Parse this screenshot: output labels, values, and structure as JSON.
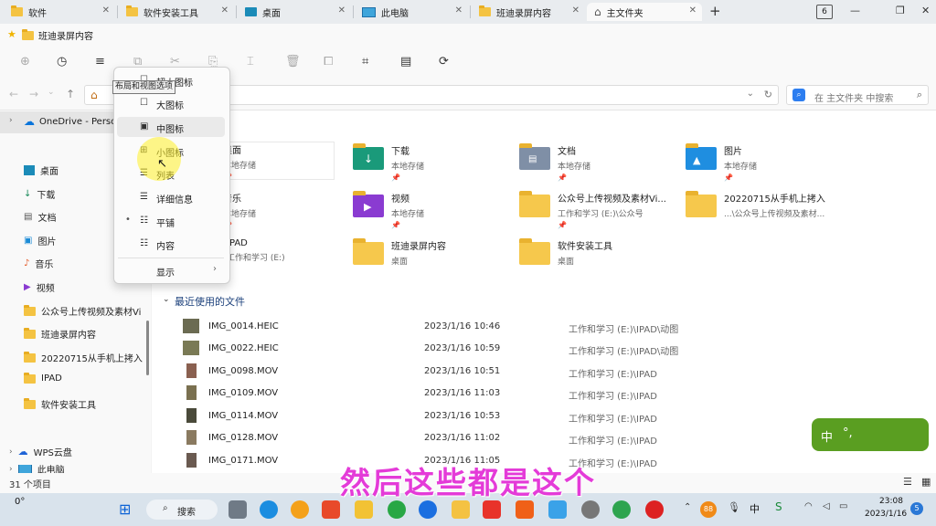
{
  "tabs": [
    {
      "label": "软件",
      "icon": "folder-icon"
    },
    {
      "label": "软件安装工具",
      "icon": "folder-icon"
    },
    {
      "label": "桌面",
      "icon": "desktop-icon"
    },
    {
      "label": "此电脑",
      "icon": "pc-icon"
    },
    {
      "label": "班迪录屏内容",
      "icon": "folder-icon"
    },
    {
      "label": "主文件夹",
      "icon": "home-icon"
    }
  ],
  "tab_count": "6",
  "tab_add": "+",
  "breadcrumb": "班迪录屏内容",
  "tooltip": "布局和视图选项",
  "search_placeholder": "在 主文件夹 中搜索",
  "view_menu": {
    "items": [
      {
        "label": "超大图标",
        "icon": "☐"
      },
      {
        "label": "大图标",
        "icon": "☐"
      },
      {
        "label": "中图标",
        "icon": "▣"
      },
      {
        "label": "小图标",
        "icon": "⊞"
      },
      {
        "label": "列表",
        "icon": "☰"
      },
      {
        "label": "详细信息",
        "icon": "☰"
      },
      {
        "label": "平铺",
        "icon": "☷"
      },
      {
        "label": "内容",
        "icon": "☷"
      }
    ],
    "bullet": "•",
    "show_label": "显示",
    "show_arrow": "›"
  },
  "sidebar": {
    "onedrive": "OneDrive - Personal",
    "items": [
      "桌面",
      "下载",
      "文档",
      "图片",
      "音乐",
      "视频",
      "公众号上传视频及素材Vi",
      "班迪录屏内容",
      "20220715从手机上拷入",
      "IPAD",
      "软件安装工具"
    ],
    "wps": "WPS云盘",
    "pc": "此电脑"
  },
  "quick_access": [
    {
      "name": "桌面",
      "sub": "本地存储",
      "pin": "📌"
    },
    {
      "name": "下载",
      "sub": "本地存储",
      "pin": "📌"
    },
    {
      "name": "文档",
      "sub": "本地存储",
      "pin": "📌"
    },
    {
      "name": "图片",
      "sub": "本地存储",
      "pin": "📌"
    },
    {
      "name": "音乐",
      "sub": "本地存储",
      "pin": "📌"
    },
    {
      "name": "视频",
      "sub": "本地存储",
      "pin": "📌"
    },
    {
      "name": "公众号上传视频及素材Vi...",
      "sub": "工作和学习 (E:)\\公众号",
      "pin": "📌"
    },
    {
      "name": "20220715从手机上拷入",
      "sub": "...\\公众号上传视频及素材...",
      "pin": ""
    },
    {
      "name": "IPAD",
      "sub": "工作和学习 (E:)",
      "pin": ""
    },
    {
      "name": "班迪录屏内容",
      "sub": "桌面",
      "pin": ""
    },
    {
      "name": "软件安装工具",
      "sub": "桌面",
      "pin": ""
    }
  ],
  "recent_title": "最近使用的文件",
  "recent": [
    {
      "name": "IMG_0014.HEIC",
      "date": "2023/1/16 10:46",
      "loc": "工作和学习 (E:)\\IPAD\\动图"
    },
    {
      "name": "IMG_0022.HEIC",
      "date": "2023/1/16 10:59",
      "loc": "工作和学习 (E:)\\IPAD\\动图"
    },
    {
      "name": "IMG_0098.MOV",
      "date": "2023/1/16 10:51",
      "loc": "工作和学习 (E:)\\IPAD"
    },
    {
      "name": "IMG_0109.MOV",
      "date": "2023/1/16 11:03",
      "loc": "工作和学习 (E:)\\IPAD"
    },
    {
      "name": "IMG_0114.MOV",
      "date": "2023/1/16 10:53",
      "loc": "工作和学习 (E:)\\IPAD"
    },
    {
      "name": "IMG_0128.MOV",
      "date": "2023/1/16 11:02",
      "loc": "工作和学习 (E:)\\IPAD"
    },
    {
      "name": "IMG_0171.MOV",
      "date": "2023/1/16 11:05",
      "loc": "工作和学习 (E:)\\IPAD"
    }
  ],
  "status": "31 个项目",
  "subtitle": "然后这些都是这个",
  "ime": {
    "lang": "中",
    "punct": "°,"
  },
  "taskbar": {
    "temp": "0°",
    "search": "搜索",
    "tray_badge": "88",
    "ime_lang": "中",
    "time": "23:08",
    "date": "2023/1/16",
    "notify": "5"
  }
}
